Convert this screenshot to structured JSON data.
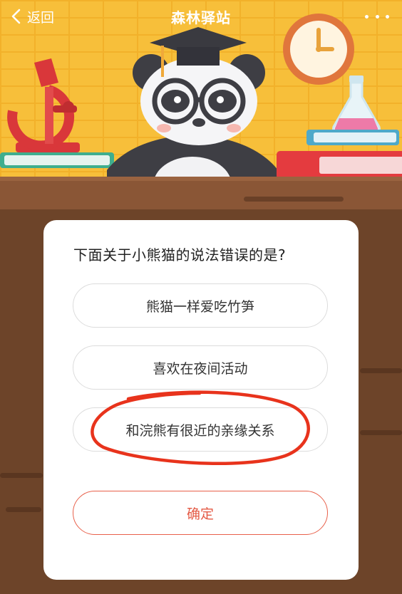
{
  "nav": {
    "back_label": "返回",
    "title": "森林驿站"
  },
  "quiz": {
    "question": "下面关于小熊猫的说法错误的是?",
    "options": [
      {
        "label": "熊猫一样爱吃竹笋"
      },
      {
        "label": "喜欢在夜间活动"
      },
      {
        "label": "和浣熊有很近的亲缘关系"
      }
    ],
    "confirm_label": "确定"
  },
  "colors": {
    "scene_background": "#f7bf3a",
    "desk": "#6d4429",
    "accent_red": "#e45a45",
    "annotation_ring": "#e8331c"
  },
  "icons": {
    "back": "chevron-left-icon",
    "more": "more-dots-icon"
  }
}
